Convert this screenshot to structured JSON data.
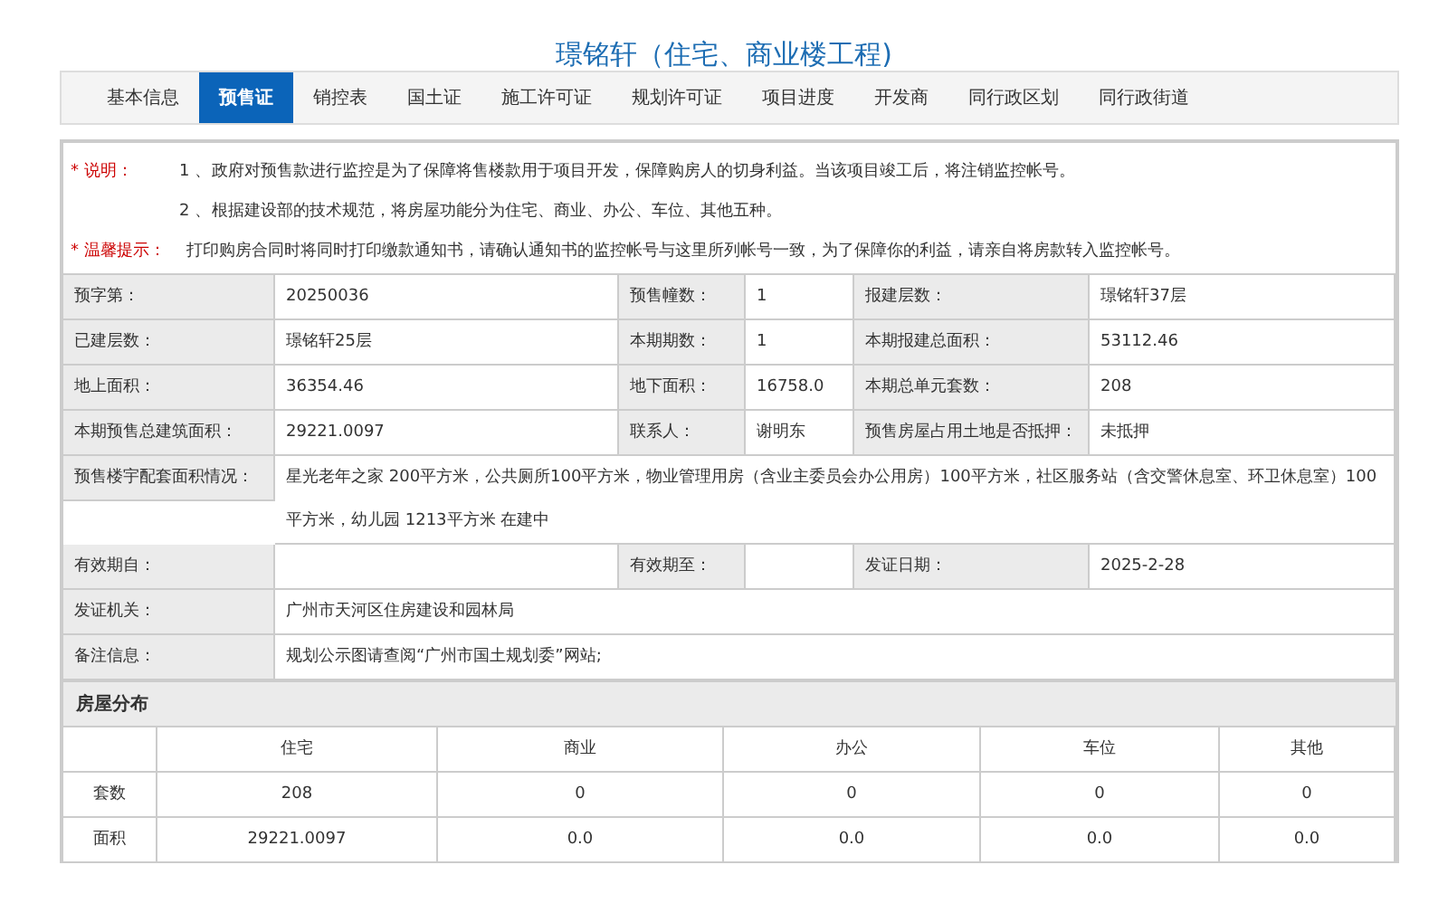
{
  "title": "璟铭轩（住宅、商业楼工程)",
  "tabs": [
    {
      "label": "基本信息",
      "selected": false
    },
    {
      "label": "预售证",
      "selected": true
    },
    {
      "label": "销控表",
      "selected": false
    },
    {
      "label": "国土证",
      "selected": false
    },
    {
      "label": "施工许可证",
      "selected": false
    },
    {
      "label": "规划许可证",
      "selected": false
    },
    {
      "label": "项目进度",
      "selected": false
    },
    {
      "label": "开发商",
      "selected": false
    },
    {
      "label": "同行政区划",
      "selected": false
    },
    {
      "label": "同行政街道",
      "selected": false
    }
  ],
  "notes": [
    {
      "label": "* 说明：",
      "items": [
        {
          "number": "1 、",
          "text": "政府对预售款进行监控是为了保障将售楼款用于项目开发，保障购房人的切身利益。当该项目竣工后，将注销监控帐号。"
        },
        {
          "number": "2 、",
          "text": "根据建设部的技术规范，将房屋功能分为住宅、商业、办公、车位、其他五种。"
        }
      ]
    },
    {
      "label": "* 温馨提示：",
      "text": "打印购房合同时将同时打印缴款通知书，请确认通知书的监控帐号与这里所列帐号一致，为了保障你的利益，请亲自将房款转入监控帐号。"
    }
  ],
  "info_rows": [
    [
      {
        "label": "预字第：",
        "value": "20250036"
      },
      {
        "label": "预售幢数：",
        "value": "1"
      },
      {
        "label": "报建层数：",
        "value": "璟铭轩37层"
      }
    ],
    [
      {
        "label": "已建层数：",
        "value": "璟铭轩25层"
      },
      {
        "label": "本期期数：",
        "value": "1"
      },
      {
        "label": "本期报建总面积：",
        "value": "53112.46"
      }
    ],
    [
      {
        "label": "地上面积：",
        "value": "36354.46"
      },
      {
        "label": "地下面积：",
        "value": "16758.0"
      },
      {
        "label": "本期总单元套数：",
        "value": "208"
      }
    ],
    [
      {
        "label": "本期预售总建筑面积：",
        "value": "29221.0097"
      },
      {
        "label": "联系人：",
        "value": "谢明东"
      },
      {
        "label": "预售房屋占用土地是否抵押：",
        "value": "未抵押"
      }
    ],
    [
      {
        "label": "预售楼宇配套面积情况：",
        "value": "星光老年之家 200平方米，公共厕所100平方米，物业管理用房（含业主委员会办公用房）100平方米，社区服务站（含交警休息室、环卫休息室）100平方米，幼儿园 1213平方米 在建中"
      }
    ],
    [
      {
        "label": "有效期自："
      },
      {
        "label": "有效期至："
      },
      {
        "label": "发证日期：",
        "value": "2025-2-28"
      }
    ],
    [
      {
        "label": "发证机关：",
        "value": "广州市天河区住房建设和园林局"
      }
    ],
    [
      {
        "label": "备注信息：",
        "value": "规划公示图请查阅“广州市国土规划委”网站;"
      }
    ]
  ],
  "distribution": {
    "title": "房屋分布",
    "columns": [
      "住宅",
      "商业",
      "办公",
      "车位",
      "其他"
    ],
    "rows": [
      {
        "label": "套数",
        "values": [
          "208",
          "0",
          "0",
          "0",
          "0"
        ]
      },
      {
        "label": "面积",
        "values": [
          "29221.0097",
          "0.0",
          "0.0",
          "0.0",
          "0.0"
        ]
      }
    ]
  }
}
